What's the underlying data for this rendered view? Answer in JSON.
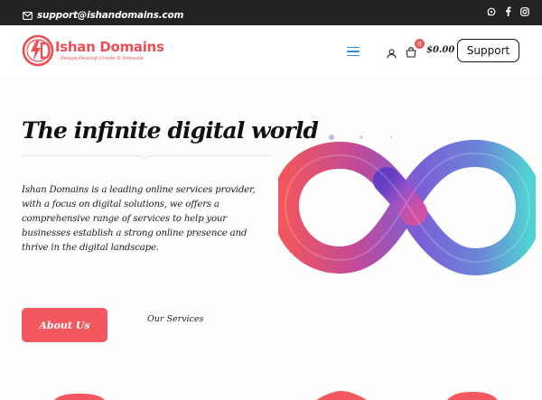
{
  "topbar": {
    "email": "support@ishandomains.com",
    "social": [
      "whatsapp-icon",
      "facebook-icon",
      "instagram-icon"
    ]
  },
  "header": {
    "logo_name": "Ishan Domains",
    "logo_tagline": "Design Develop Create & Innovate",
    "cart_count": "0",
    "cart_total": "$0.00",
    "support_label": "Support"
  },
  "hero": {
    "title": "The infinite digital world",
    "description": "Ishan Domains is a leading online services provider, with a focus on digital solutions, we offers a comprehensive range of services to help your businesses establish a strong online presence and thrive in the digital landscape.",
    "about_label": "About Us",
    "services_label": "Our Services"
  },
  "colors": {
    "brand": "#ec4e51",
    "button": "#f2585d",
    "topbar": "#232323",
    "menu_accent": "#2f8fd9"
  }
}
